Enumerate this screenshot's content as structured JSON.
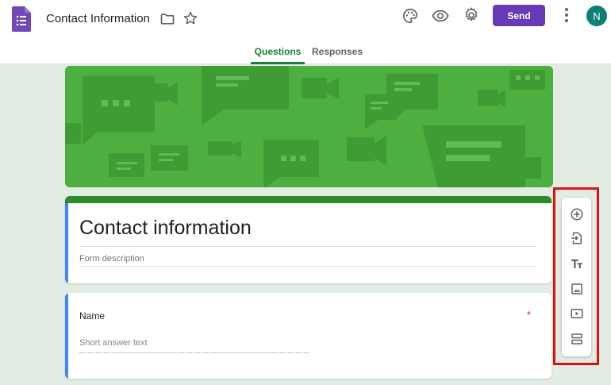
{
  "header": {
    "doc_title": "Contact Information",
    "send_label": "Send",
    "avatar_initial": "N",
    "brand_color": "#673ab7"
  },
  "tabs": [
    {
      "label": "Questions",
      "active": true
    },
    {
      "label": "Responses",
      "active": false
    }
  ],
  "form": {
    "title": "Contact information",
    "description_placeholder": "Form description",
    "theme_color": "#2e8b2a"
  },
  "question": {
    "title": "Name",
    "required_mark": "*",
    "answer_placeholder": "Short answer text"
  },
  "toolbar": {
    "items": [
      "add-question-icon",
      "import-questions-icon",
      "add-title-icon",
      "add-image-icon",
      "add-video-icon",
      "add-section-icon"
    ]
  }
}
